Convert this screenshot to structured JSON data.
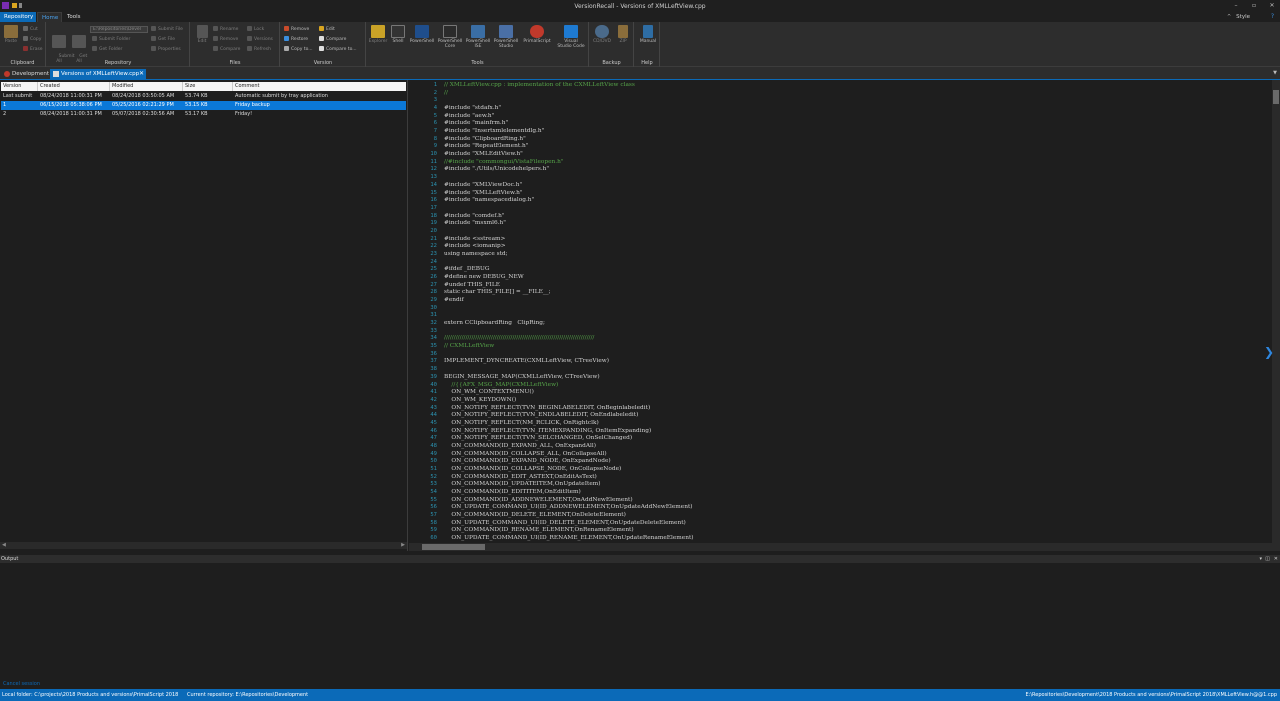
{
  "window": {
    "title": "VersionRecall  -  Versions of XMLLeftView.cpp"
  },
  "ribbon": {
    "tabs": [
      "Repository",
      "Home",
      "Tools"
    ],
    "style_label": "Style",
    "groups": {
      "clipboard": {
        "label": "Clipboard",
        "paste": "Paste",
        "cut": "Cut",
        "copy": "Copy",
        "erase": "Erase"
      },
      "repository": {
        "label": "Repository",
        "submit_all": "Submit\nAll",
        "get_all": "Get\nAll",
        "path_combo": "E:\\Repositories\\Devel",
        "submit_folder": "Submit Folder",
        "get_folder": "Get Folder",
        "submit_file": "Submit File",
        "get_file": "Get File",
        "properties": "Properties"
      },
      "files": {
        "label": "Files",
        "edit": "Edit",
        "rename": "Rename",
        "remove": "Remove",
        "compare": "Compare",
        "lock": "Lock",
        "versions": "Versions",
        "refresh": "Refresh"
      },
      "version": {
        "label": "Version",
        "remove": "Remove",
        "restore": "Restore",
        "copy_to": "Copy to...",
        "edit": "Edit",
        "compare": "Compare",
        "compare_to": "Compare to..."
      },
      "tools": {
        "label": "Tools",
        "items": [
          "Explorer",
          "Shell",
          "PowerShell",
          "PowerShell\nCore",
          "PowerShell\nISE",
          "PowerShell\nStudio",
          "PrimalScript",
          "Visual\nStudio Code"
        ]
      },
      "backup": {
        "label": "Backup",
        "items": [
          "CD/DVD",
          "ZIP"
        ]
      },
      "help": {
        "label": "Help",
        "manual": "Manual"
      }
    }
  },
  "doc_tabs": [
    {
      "label": "Development",
      "active": false
    },
    {
      "label": "Versions of XMLLeftView.cpp",
      "active": true
    }
  ],
  "versions_grid": {
    "columns": [
      "Version",
      "Created",
      "Modified",
      "Size",
      "Comment"
    ],
    "rows": [
      {
        "version": "Last submit",
        "created": "08/24/2018 11:00:31 PM",
        "modified": "08/24/2018 03:50:05 AM",
        "size": "53.74 KB",
        "comment": "Automatic submit by tray application",
        "selected": false
      },
      {
        "version": "1",
        "created": "06/15/2018 05:38:06 PM",
        "modified": "05/25/2016 02:21:29 PM",
        "size": "53.15 KB",
        "comment": "Friday backup",
        "selected": true
      },
      {
        "version": "2",
        "created": "08/24/2018 11:00:31 PM",
        "modified": "05/07/2018 02:30:56 AM",
        "size": "53.17 KB",
        "comment": "Friday!",
        "selected": false
      }
    ]
  },
  "code_lines": [
    {
      "n": "1",
      "t": "// XMLLeftView.cpp : implementation of the CXMLLeftView class",
      "c": true
    },
    {
      "n": "2",
      "t": "//",
      "c": true
    },
    {
      "n": "3",
      "t": "",
      "c": false
    },
    {
      "n": "4",
      "t": "#include \"stdafx.h\"",
      "c": false
    },
    {
      "n": "5",
      "t": "#include \"aew.h\"",
      "c": false
    },
    {
      "n": "6",
      "t": "#include \"mainfrm.h\"",
      "c": false
    },
    {
      "n": "7",
      "t": "#include \"Insertxmlelementdlg.h\"",
      "c": false
    },
    {
      "n": "8",
      "t": "#include \"ClipboardRing.h\"",
      "c": false
    },
    {
      "n": "9",
      "t": "#include \"RepeatElement.h\"",
      "c": false
    },
    {
      "n": "10",
      "t": "#include \"XMLEditView.h\"",
      "c": false
    },
    {
      "n": "11",
      "t": "//#include \"commongui/VistaFileopen.h\"",
      "c": true
    },
    {
      "n": "12",
      "t": "#include \"./Utils/Unicodehelpers.h\"",
      "c": false
    },
    {
      "n": "13",
      "t": "",
      "c": false
    },
    {
      "n": "14",
      "t": "#include \"XMLViewDoc.h\"",
      "c": false
    },
    {
      "n": "15",
      "t": "#include \"XMLLeftView.h\"",
      "c": false
    },
    {
      "n": "16",
      "t": "#include \"namespacedialog.h\"",
      "c": false
    },
    {
      "n": "17",
      "t": "",
      "c": false
    },
    {
      "n": "18",
      "t": "#include \"comdef.h\"",
      "c": false
    },
    {
      "n": "19",
      "t": "#include \"msxml6.h\"",
      "c": false
    },
    {
      "n": "20",
      "t": "",
      "c": false
    },
    {
      "n": "21",
      "t": "#include <sstream>",
      "c": false
    },
    {
      "n": "22",
      "t": "#include <iomanip>",
      "c": false
    },
    {
      "n": "23",
      "t": "using namespace std;",
      "c": false
    },
    {
      "n": "24",
      "t": "",
      "c": false
    },
    {
      "n": "25",
      "t": "#ifdef _DEBUG",
      "c": false
    },
    {
      "n": "26",
      "t": "#define new DEBUG_NEW",
      "c": false
    },
    {
      "n": "27",
      "t": "#undef THIS_FILE",
      "c": false
    },
    {
      "n": "28",
      "t": "static char THIS_FILE[] = __FILE__;",
      "c": false
    },
    {
      "n": "29",
      "t": "#endif",
      "c": false
    },
    {
      "n": "30",
      "t": "",
      "c": false
    },
    {
      "n": "31",
      "t": "",
      "c": false
    },
    {
      "n": "32",
      "t": "extern CClipboardRing   ClipRing;",
      "c": false
    },
    {
      "n": "33",
      "t": "",
      "c": false
    },
    {
      "n": "34",
      "t": "/////////////////////////////////////////////////////////////////////////////",
      "c": true
    },
    {
      "n": "35",
      "t": "// CXMLLeftView",
      "c": true
    },
    {
      "n": "36",
      "t": "",
      "c": false
    },
    {
      "n": "37",
      "t": "IMPLEMENT_DYNCREATE(CXMLLeftView, CTreeView)",
      "c": false
    },
    {
      "n": "38",
      "t": "",
      "c": false
    },
    {
      "n": "39",
      "t": "BEGIN_MESSAGE_MAP(CXMLLeftView, CTreeView)",
      "c": false
    },
    {
      "n": "40",
      "t": "    //{{AFX_MSG_MAP(CXMLLeftView)",
      "c": true
    },
    {
      "n": "41",
      "t": "    ON_WM_CONTEXTMENU()",
      "c": false
    },
    {
      "n": "42",
      "t": "    ON_WM_KEYDOWN()",
      "c": false
    },
    {
      "n": "43",
      "t": "    ON_NOTIFY_REFLECT(TVN_BEGINLABELEDIT, OnBeginlabeledit)",
      "c": false
    },
    {
      "n": "44",
      "t": "    ON_NOTIFY_REFLECT(TVN_ENDLABELEDIT, OnEndlabeledit)",
      "c": false
    },
    {
      "n": "45",
      "t": "    ON_NOTIFY_REFLECT(NM_RCLICK, OnRightclk)",
      "c": false
    },
    {
      "n": "46",
      "t": "    ON_NOTIFY_REFLECT(TVN_ITEMEXPANDING, OnItemExpanding)",
      "c": false
    },
    {
      "n": "47",
      "t": "    ON_NOTIFY_REFLECT(TVN_SELCHANGED, OnSelChanged)",
      "c": false
    },
    {
      "n": "48",
      "t": "    ON_COMMAND(ID_EXPAND_ALL, OnExpandAll)",
      "c": false
    },
    {
      "n": "49",
      "t": "    ON_COMMAND(ID_COLLAPSE_ALL, OnCollapseAll)",
      "c": false
    },
    {
      "n": "50",
      "t": "    ON_COMMAND(ID_EXPAND_NODE, OnExpandNode)",
      "c": false
    },
    {
      "n": "51",
      "t": "    ON_COMMAND(ID_COLLAPSE_NODE, OnCollapseNode)",
      "c": false
    },
    {
      "n": "52",
      "t": "    ON_COMMAND(ID_EDIT_ASTEXT,OnEditAsText)",
      "c": false
    },
    {
      "n": "53",
      "t": "    ON_COMMAND(ID_UPDATEITEM,OnUpdateItem)",
      "c": false
    },
    {
      "n": "54",
      "t": "    ON_COMMAND(ID_EDITITEM,OnEditItem)",
      "c": false
    },
    {
      "n": "55",
      "t": "    ON_COMMAND(ID_ADDNEWELEMENT,OnAddNewElement)",
      "c": false
    },
    {
      "n": "56",
      "t": "    ON_UPDATE_COMMAND_UI(ID_ADDNEWELEMENT,OnUpdateAddNewElement)",
      "c": false
    },
    {
      "n": "57",
      "t": "    ON_COMMAND(ID_DELETE_ELEMENT,OnDeleteElement)",
      "c": false
    },
    {
      "n": "58",
      "t": "    ON_UPDATE_COMMAND_UI(ID_DELETE_ELEMENT,OnUpdateDeleteElement)",
      "c": false
    },
    {
      "n": "59",
      "t": "    ON_COMMAND(ID_RENAME_ELEMENT,OnRenameElement)",
      "c": false
    },
    {
      "n": "60",
      "t": "    ON_UPDATE_COMMAND_UI(ID_RENAME_ELEMENT,OnUpdateRenameElement)",
      "c": false
    }
  ],
  "output": {
    "title": "Output",
    "cancel_label": "Cancel session"
  },
  "status": {
    "local_folder": "Local folder: C:\\projects\\2018 Products and versions\\PrimalScript 2018",
    "current_repo": "Current repository: E:\\Repositories\\Development",
    "right_path": "E:\\Repositories\\Development\\2018 Products and versions\\PrimalScript 2018\\XMLLeftView.h@@1.cpp"
  },
  "colors": {
    "accent": "#0b6ab8",
    "selection": "#0b78d7",
    "comment": "#57a64a",
    "line_number": "#2b91af"
  }
}
